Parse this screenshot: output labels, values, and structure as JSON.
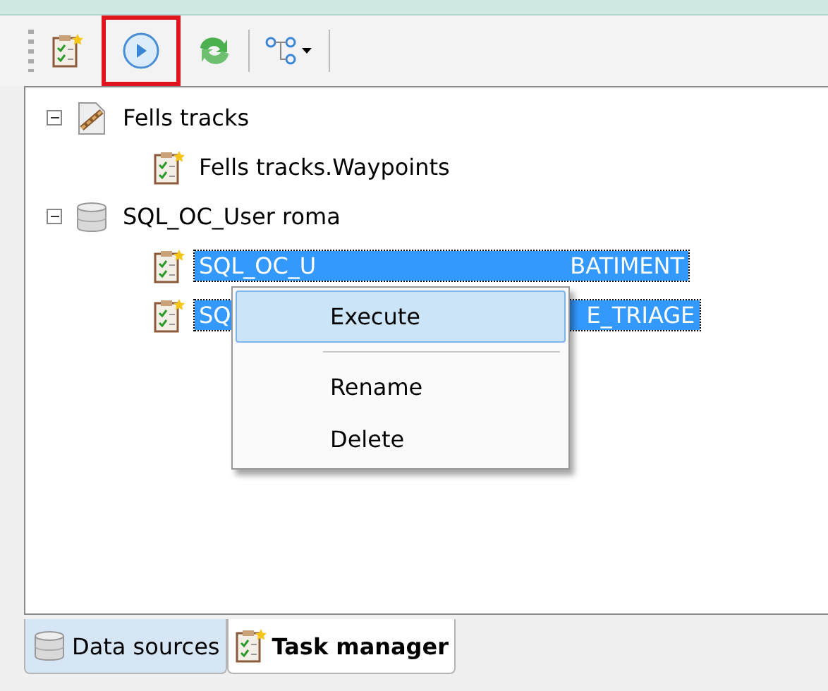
{
  "toolbar": {
    "buttons": [
      {
        "kind": "task",
        "highlighted": false
      },
      {
        "kind": "run",
        "highlighted": true
      },
      {
        "kind": "refresh",
        "highlighted": false
      },
      {
        "kind": "diagram",
        "highlighted": false
      }
    ]
  },
  "tree": [
    {
      "label": "Fells tracks",
      "kind": "tracks",
      "expanded": true,
      "children": [
        {
          "label": "Fells tracks.Waypoints",
          "kind": "task",
          "selected": false
        }
      ]
    },
    {
      "label": "SQL_OC_User roma",
      "kind": "database",
      "expanded": true,
      "children": [
        {
          "label_start": "SQL_OC_U",
          "label_end": "BATIMENT",
          "kind": "task",
          "selected": true
        },
        {
          "label_start": "SQ",
          "label_end": "E_TRIAGE",
          "kind": "task",
          "selected": true
        }
      ]
    }
  ],
  "context_menu": {
    "items": [
      {
        "kind": "item",
        "label": "Execute",
        "selected": true
      },
      {
        "kind": "separator"
      },
      {
        "kind": "item",
        "label": "Rename",
        "selected": false
      },
      {
        "kind": "item",
        "label": "Delete",
        "selected": false
      }
    ]
  },
  "tabs": [
    {
      "label": "Data sources",
      "kind": "database",
      "selected": false
    },
    {
      "label": "Task manager",
      "kind": "task",
      "selected": true
    }
  ]
}
